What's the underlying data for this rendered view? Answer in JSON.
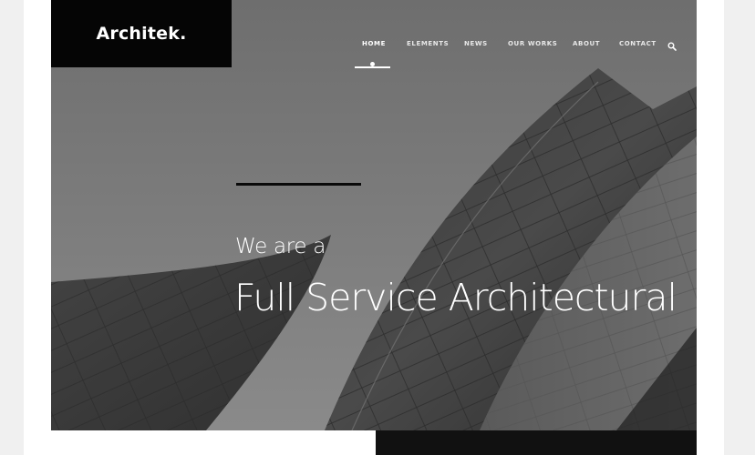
{
  "brand": {
    "logo": "Architek."
  },
  "nav": {
    "items": [
      {
        "label": "HOME",
        "active": true
      },
      {
        "label": "ELEMENTS",
        "active": false
      },
      {
        "label": "NEWS",
        "active": false
      },
      {
        "label": "OUR WORKS",
        "active": false
      },
      {
        "label": "ABOUT",
        "active": false
      },
      {
        "label": "CONTACT",
        "active": false
      }
    ],
    "search_icon": "search-icon"
  },
  "hero": {
    "subtitle": "We are a",
    "title": "Full Service Architectural"
  },
  "colors": {
    "logo_bg": "#050505",
    "text": "#ffffff",
    "accent_rule": "#0a0a0a",
    "page_bg": "#ffffff",
    "outer_bg": "#f0f0f0"
  }
}
